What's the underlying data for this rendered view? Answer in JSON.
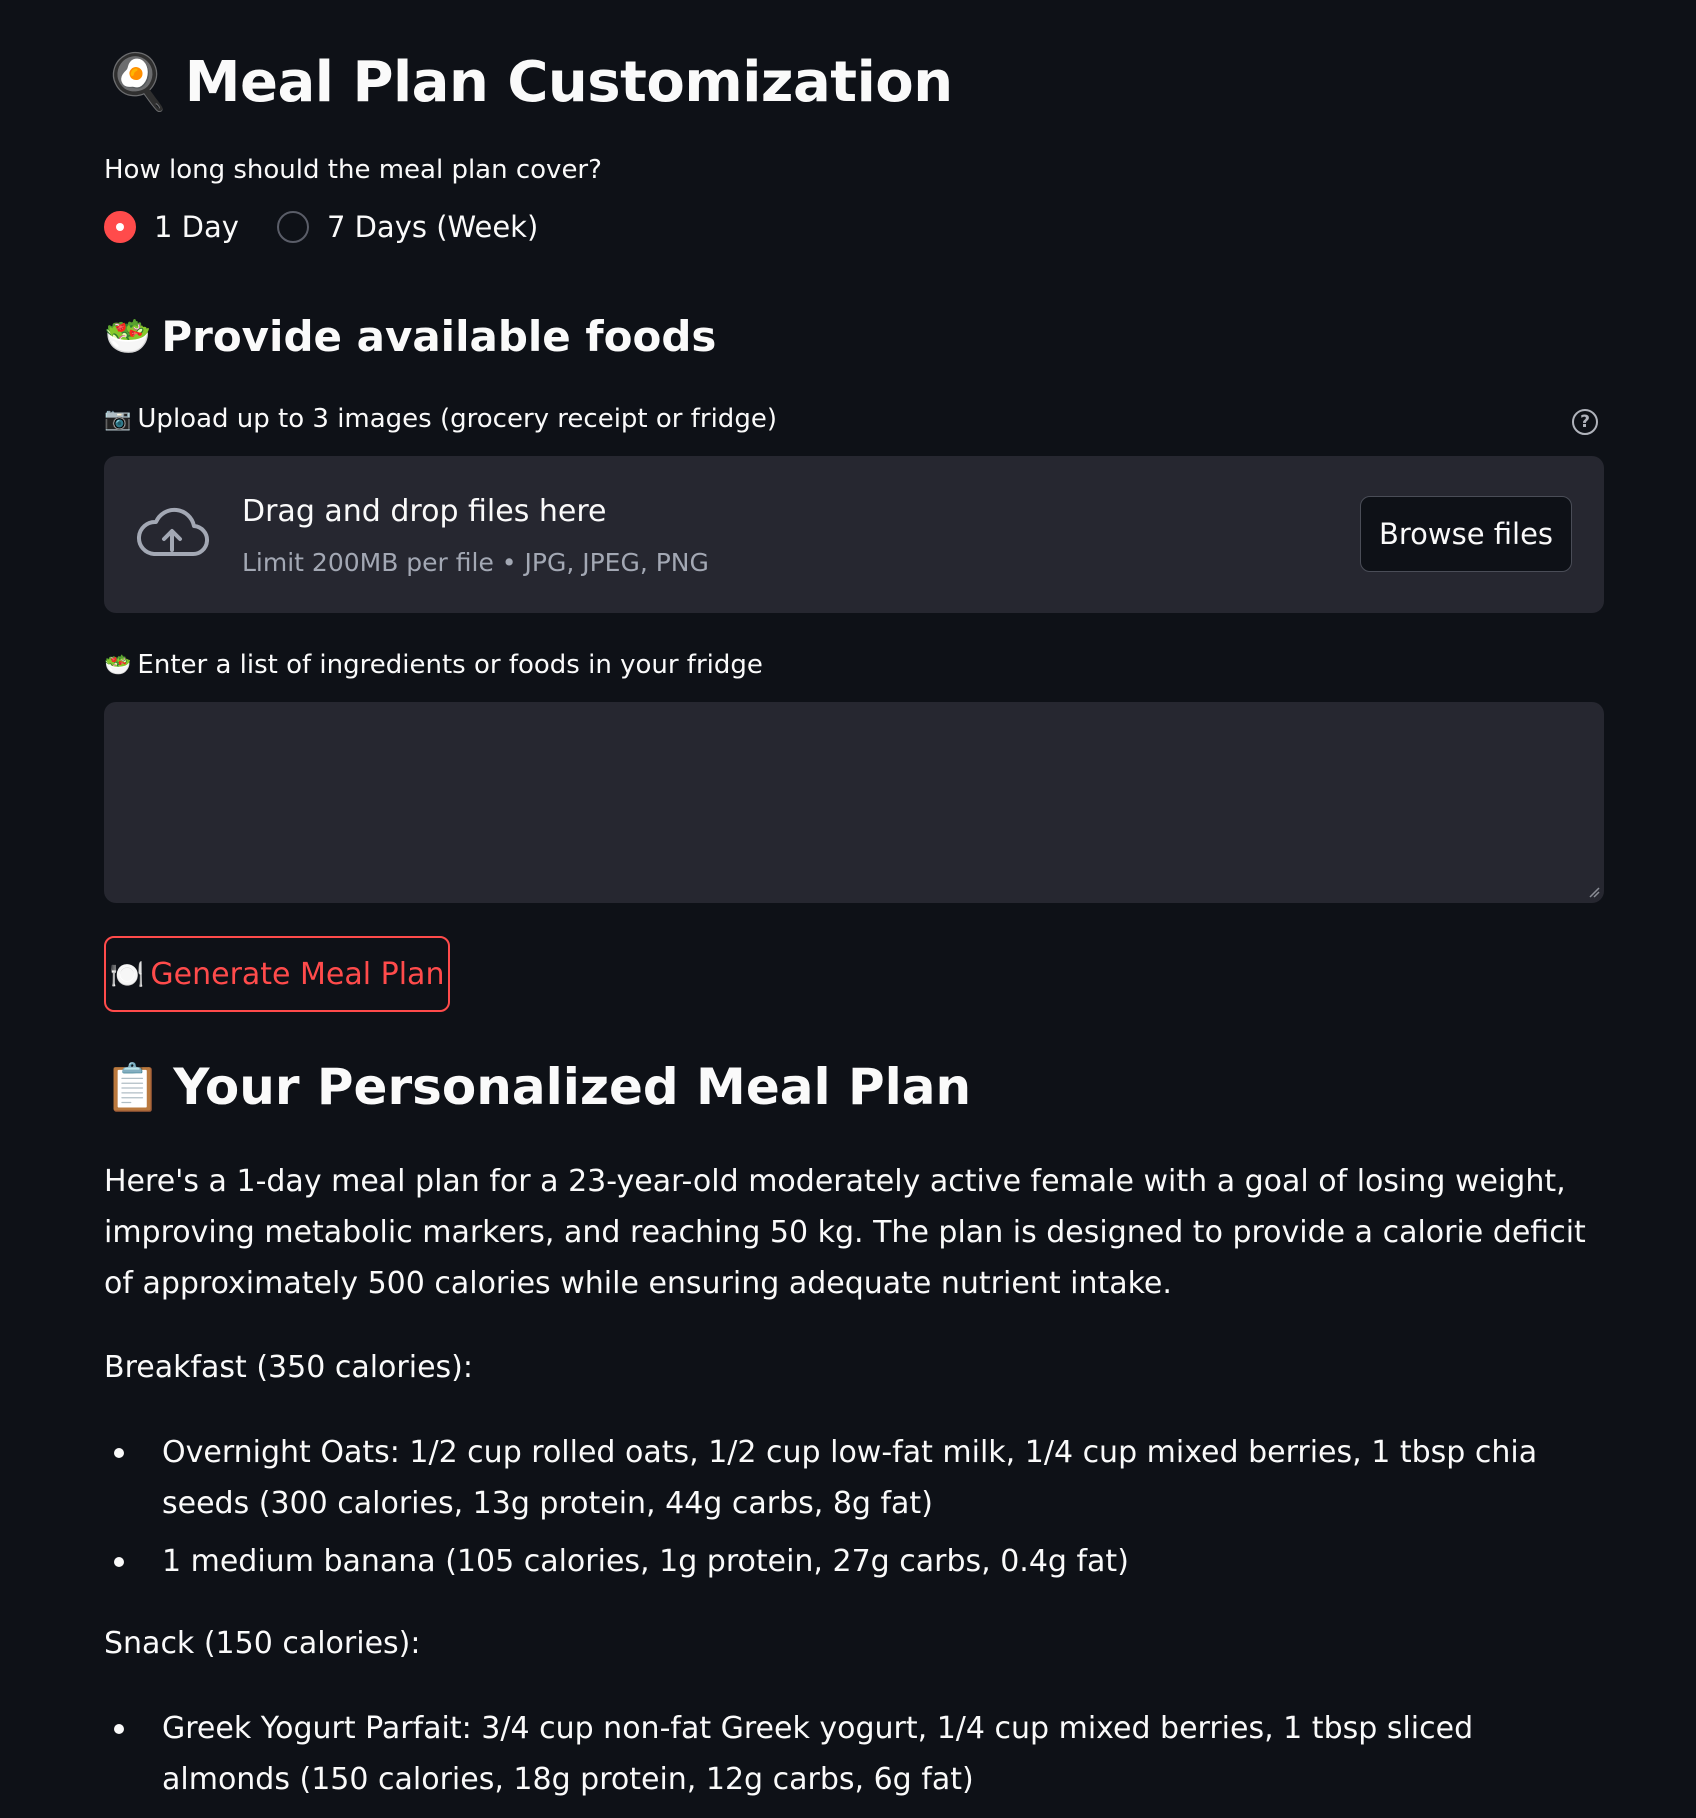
{
  "page": {
    "title": "Meal Plan Customization",
    "title_emoji": "🍳"
  },
  "duration": {
    "label": "How long should the meal plan cover?",
    "options": [
      {
        "label": "1 Day",
        "selected": true
      },
      {
        "label": "7 Days (Week)",
        "selected": false
      }
    ]
  },
  "foods_section": {
    "heading": "Provide available foods",
    "heading_emoji": "🥗"
  },
  "upload": {
    "label": "Upload up to 3 images (grocery receipt or fridge)",
    "label_emoji": "📷",
    "help_icon": "?",
    "drop_title": "Drag and drop files here",
    "drop_subtitle": "Limit 200MB per file • JPG, JPEG, PNG",
    "browse_label": "Browse files"
  },
  "ingredients": {
    "label": "Enter a list of ingredients or foods in your fridge",
    "label_emoji": "🥗",
    "value": ""
  },
  "generate": {
    "label": "Generate Meal Plan",
    "emoji": "🍽️"
  },
  "result": {
    "heading": "Your Personalized Meal Plan",
    "heading_emoji": "📋",
    "intro": "Here's a 1-day meal plan for a 23-year-old moderately active female with a goal of losing weight, improving metabolic markers, and reaching 50 kg. The plan is designed to provide a calorie deficit of approximately 500 calories while ensuring adequate nutrient intake.",
    "breakfast_title": "Breakfast (350 calories):",
    "breakfast_items": [
      "Overnight Oats: 1/2 cup rolled oats, 1/2 cup low-fat milk, 1/4 cup mixed berries, 1 tbsp chia seeds (300 calories, 13g protein, 44g carbs, 8g fat)",
      "1 medium banana (105 calories, 1g protein, 27g carbs, 0.4g fat)"
    ],
    "snack_title": "Snack (150 calories):",
    "snack_items": [
      "Greek Yogurt Parfait: 3/4 cup non-fat Greek yogurt, 1/4 cup mixed berries, 1 tbsp sliced almonds (150 calories, 18g protein, 12g carbs, 6g fat)"
    ]
  },
  "colors": {
    "background": "#0e1117",
    "surface": "#262730",
    "accent": "#ff4b4b",
    "text": "#fafafa",
    "muted_text": "#a3a8b4"
  }
}
